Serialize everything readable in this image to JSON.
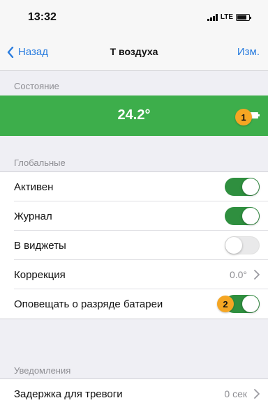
{
  "status_bar": {
    "time": "13:32",
    "network": "LTE"
  },
  "nav": {
    "back_label": "Назад",
    "title": "T воздуха",
    "edit_label": "Изм."
  },
  "state_section": {
    "header": "Состояние",
    "temperature": "24.2°",
    "bar_color": "#3dae4b"
  },
  "global_section": {
    "header": "Глобальные",
    "rows": [
      {
        "label": "Активен",
        "toggle": true
      },
      {
        "label": "Журнал",
        "toggle": true
      },
      {
        "label": "В виджеты",
        "toggle": false
      },
      {
        "label": "Коррекция",
        "value": "0.0°"
      },
      {
        "label": "Оповещать о разряде батареи",
        "toggle": true
      }
    ]
  },
  "notifications_section": {
    "header": "Уведомления",
    "rows": [
      {
        "label": "Задержка для тревоги",
        "value": "0 сек"
      }
    ]
  },
  "annotations": {
    "badge_1": "1",
    "badge_2": "2",
    "badge_color": "#f5a623"
  },
  "colors": {
    "accent": "#2a7ddf",
    "toggle_on": "#2f8f3f"
  }
}
